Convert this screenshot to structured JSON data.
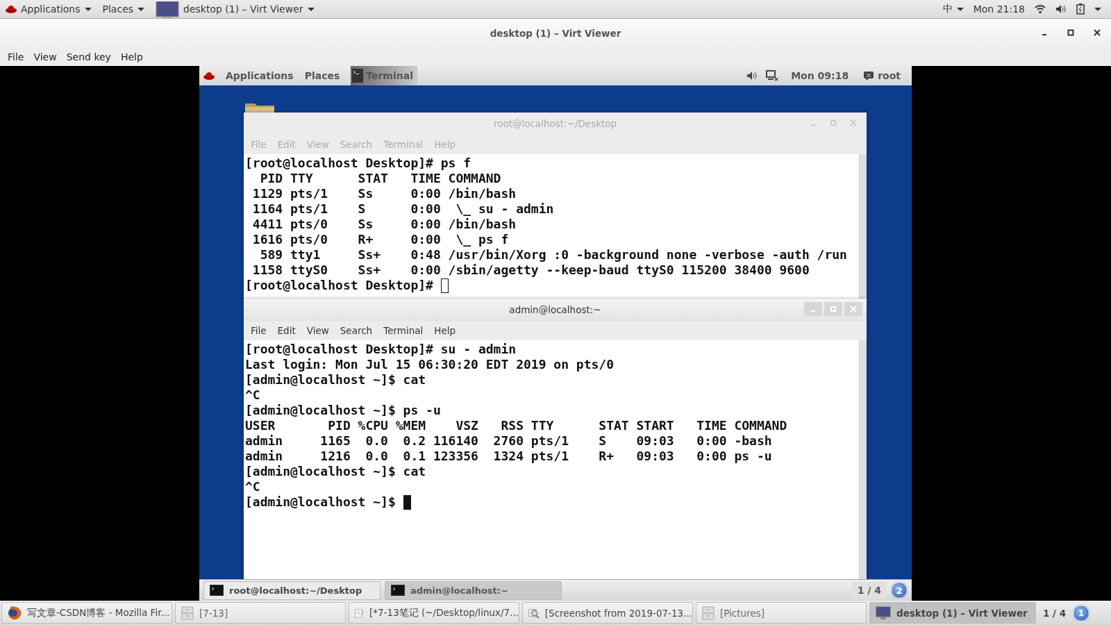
{
  "host_topbar": {
    "menus": [
      {
        "label": "Applications"
      },
      {
        "label": "Places"
      }
    ],
    "window_button": "desktop (1) – Virt Viewer",
    "input_method": "中",
    "clock": "Mon 21:18"
  },
  "viewer": {
    "title": "desktop (1) – Virt Viewer",
    "menu": [
      "File",
      "View",
      "Send key",
      "Help"
    ]
  },
  "guest": {
    "topbar": {
      "menus": [
        "Applications",
        "Places"
      ],
      "app": "Terminal",
      "clock": "Mon 09:18",
      "user": "root"
    },
    "windows": [
      {
        "title": "root@localhost:~/Desktop",
        "focused": false,
        "menu": [
          "File",
          "Edit",
          "View",
          "Search",
          "Terminal",
          "Help"
        ],
        "lines": [
          "[root@localhost Desktop]# ps f",
          "  PID TTY      STAT   TIME COMMAND",
          " 1129 pts/1    Ss     0:00 /bin/bash",
          " 1164 pts/1    S      0:00  \\_ su - admin",
          " 4411 pts/0    Ss     0:00 /bin/bash",
          " 1616 pts/0    R+     0:00  \\_ ps f",
          "  589 tty1     Ss+    0:48 /usr/bin/Xorg :0 -background none -verbose -auth /run",
          " 1158 ttyS0    Ss+    0:00 /sbin/agetty --keep-baud ttyS0 115200 38400 9600",
          "[root@localhost Desktop]# "
        ]
      },
      {
        "title": "admin@localhost:~",
        "focused": true,
        "menu": [
          "File",
          "Edit",
          "View",
          "Search",
          "Terminal",
          "Help"
        ],
        "lines": [
          "[root@localhost Desktop]# su - admin",
          "Last login: Mon Jul 15 06:30:20 EDT 2019 on pts/0",
          "[admin@localhost ~]$ cat",
          "^C",
          "[admin@localhost ~]$ ps -u",
          "USER       PID %CPU %MEM    VSZ   RSS TTY      STAT START   TIME COMMAND",
          "admin     1165  0.0  0.2 116140  2760 pts/1    S    09:03   0:00 -bash",
          "admin     1216  0.0  0.1 123356  1324 pts/1    R+   09:03   0:00 ps -u",
          "[admin@localhost ~]$ cat",
          "^C",
          "[admin@localhost ~]$ "
        ]
      }
    ],
    "bottom_bar": {
      "tasks": [
        {
          "label": "root@localhost:~/Desktop",
          "selected": false
        },
        {
          "label": "admin@localhost:~",
          "selected": true
        }
      ],
      "workspace": "1 / 4",
      "badge": "2"
    }
  },
  "host_taskbar": {
    "tasks": [
      {
        "kind": "browser",
        "label": "写文章-CSDN博客 - Mozilla Fir...",
        "selected": false
      },
      {
        "kind": "files",
        "label": "[7-13]",
        "selected": false
      },
      {
        "kind": "editor",
        "label": "[*7-13笔记 (~/Desktop/linux/7...",
        "selected": false
      },
      {
        "kind": "viewer",
        "label": "[Screenshot from 2019-07-13...",
        "selected": false
      },
      {
        "kind": "files",
        "label": "[Pictures]",
        "selected": false
      },
      {
        "kind": "monitor",
        "label": "desktop (1) – Virt Viewer",
        "selected": true
      }
    ],
    "workspace": "1 / 4",
    "badge": "1"
  }
}
